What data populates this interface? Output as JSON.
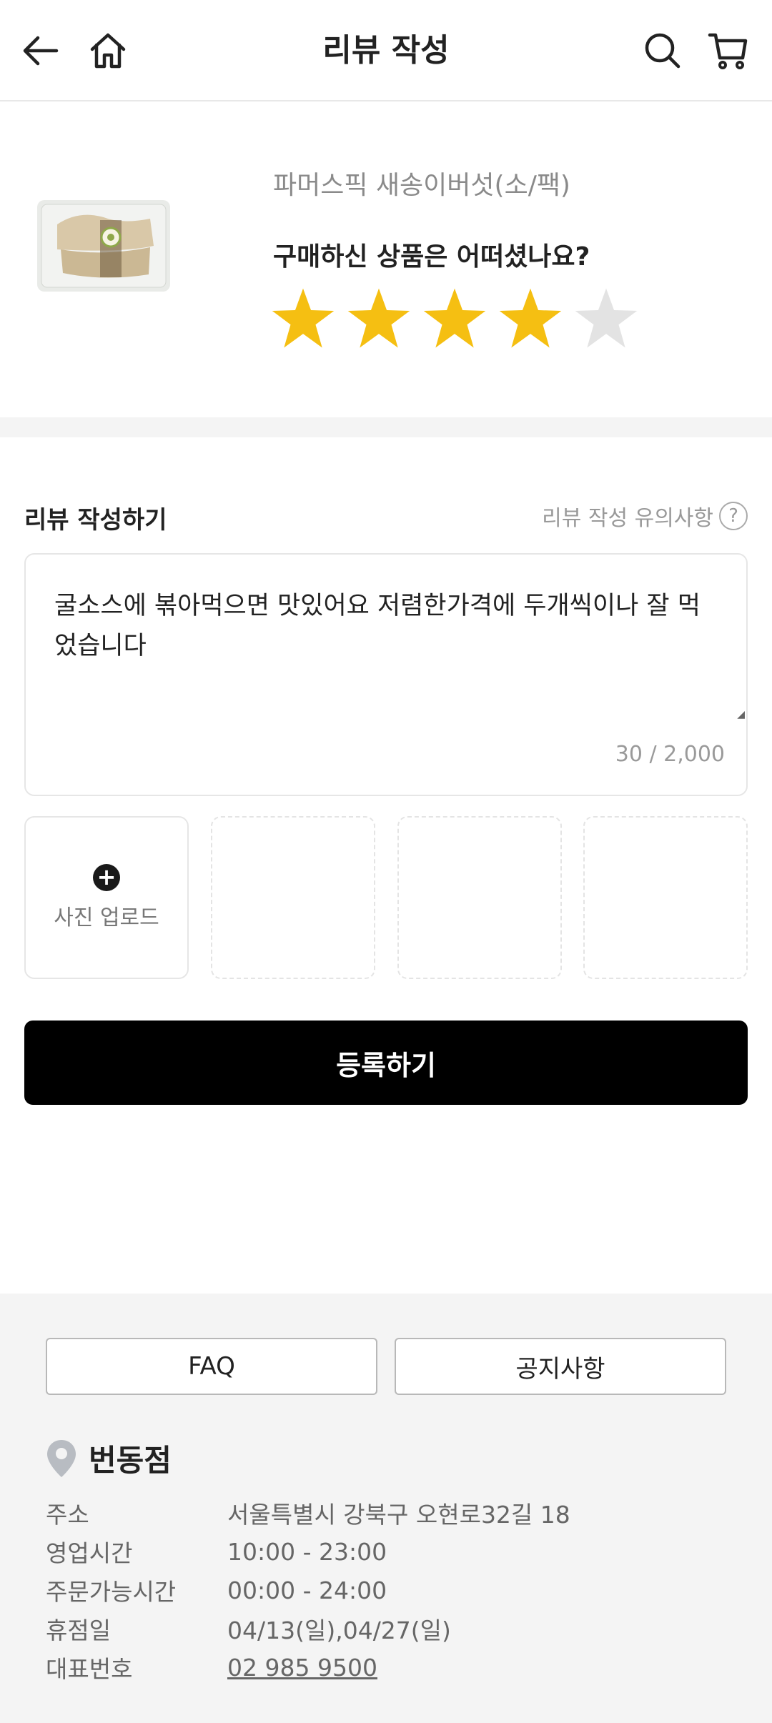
{
  "header": {
    "title": "리뷰 작성",
    "back_icon": "arrow-left-icon",
    "home_icon": "home-icon",
    "search_icon": "search-icon",
    "cart_icon": "cart-icon"
  },
  "product": {
    "name": "파머스픽 새송이버섯(소/팩)",
    "question": "구매하신 상품은 어떠셨나요?",
    "rating": 4,
    "rating_max": 5,
    "star_color_on": "#f5bf12",
    "star_color_off": "#e3e3e3"
  },
  "review": {
    "section_label": "리뷰 작성하기",
    "notice_label": "리뷰 작성 유의사항",
    "notice_icon": "?",
    "text": "굴소스에 볶아먹으면 맛있어요 저렴한가격에 두개씩이나 잘 먹었습니다",
    "counter": "30 / 2,000"
  },
  "photos": {
    "upload_label": "사진 업로드",
    "plus": "+",
    "empty_slots": 3
  },
  "submit_label": "등록하기",
  "footer": {
    "faq_label": "FAQ",
    "notice_label": "공지사항",
    "store_name": "번동점",
    "info": [
      {
        "key": "주소",
        "value": "서울특별시 강북구 오현로32길 18"
      },
      {
        "key": "영업시간",
        "value": "10:00 - 23:00"
      },
      {
        "key": "주문가능시간",
        "value": "00:00 - 24:00"
      },
      {
        "key": "휴점일",
        "value": "04/13(일),04/27(일)"
      },
      {
        "key": "대표번호",
        "value": "02 985 9500"
      }
    ]
  }
}
